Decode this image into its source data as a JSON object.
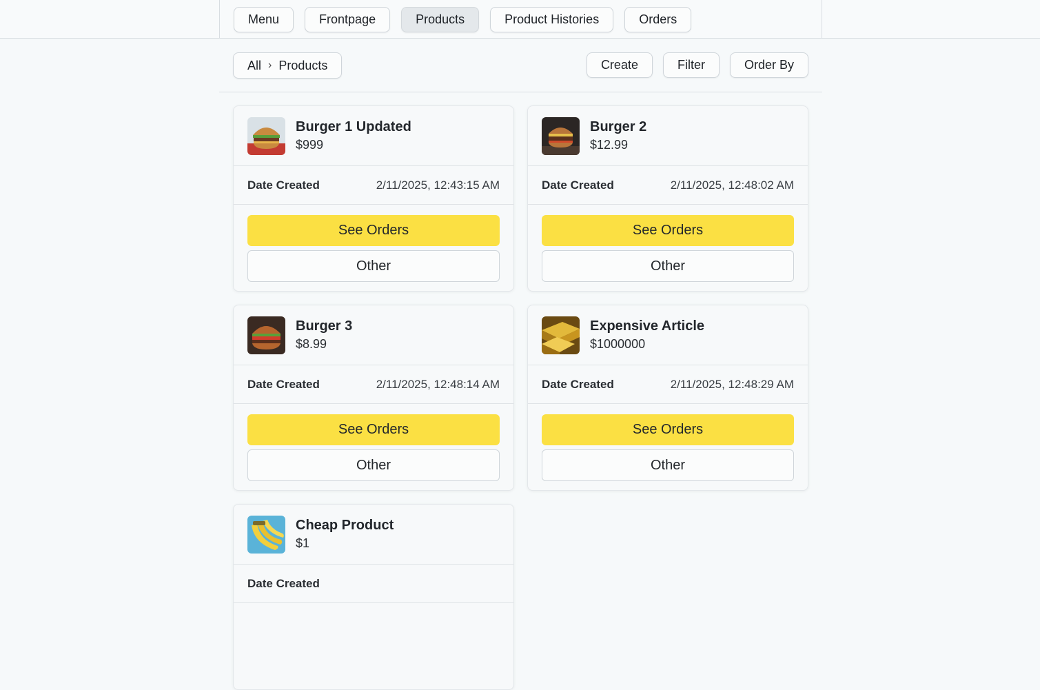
{
  "nav": {
    "items": [
      {
        "label": "Menu"
      },
      {
        "label": "Frontpage"
      },
      {
        "label": "Products"
      },
      {
        "label": "Product Histories"
      },
      {
        "label": "Orders"
      }
    ],
    "active": "Products"
  },
  "breadcrumb": {
    "root": "All",
    "separator": "›",
    "current": "Products"
  },
  "toolbar": {
    "create": "Create",
    "filter": "Filter",
    "order_by": "Order By"
  },
  "labels": {
    "date_created": "Date Created",
    "see_orders": "See Orders",
    "other": "Other"
  },
  "colors": {
    "primary_button": "#fbe043",
    "background": "#f6f9fa"
  },
  "products": [
    {
      "name": "Burger 1 Updated",
      "price": "$999",
      "date_created": "2/11/2025, 12:43:15 AM",
      "image": "burger-image"
    },
    {
      "name": "Burger 2",
      "price": "$12.99",
      "date_created": "2/11/2025, 12:48:02 AM",
      "image": "burger-image"
    },
    {
      "name": "Burger 3",
      "price": "$8.99",
      "date_created": "2/11/2025, 12:48:14 AM",
      "image": "burger-image"
    },
    {
      "name": "Expensive Article",
      "price": "$1000000",
      "date_created": "2/11/2025, 12:48:29 AM",
      "image": "gold-bars-image"
    },
    {
      "name": "Cheap Product",
      "price": "$1",
      "date_created": "",
      "image": "bananas-image"
    }
  ]
}
